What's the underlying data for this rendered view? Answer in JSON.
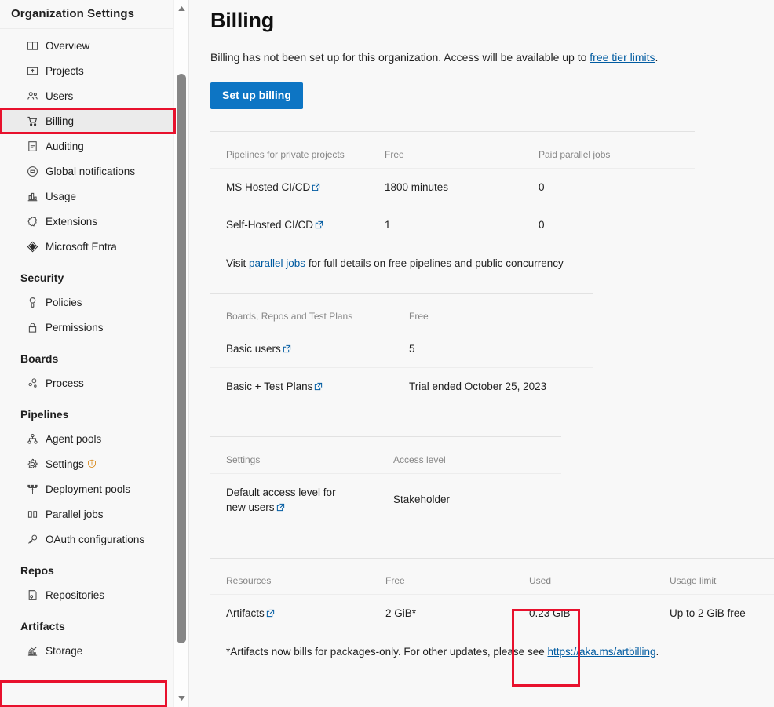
{
  "sidebar": {
    "title": "Organization Settings",
    "items": [
      {
        "label": "Overview",
        "icon": "overview-icon",
        "selected": false
      },
      {
        "label": "Projects",
        "icon": "projects-icon",
        "selected": false
      },
      {
        "label": "Users",
        "icon": "users-icon",
        "selected": false
      },
      {
        "label": "Billing",
        "icon": "billing-cart-icon",
        "selected": true
      },
      {
        "label": "Auditing",
        "icon": "auditing-icon",
        "selected": false
      },
      {
        "label": "Global notifications",
        "icon": "notifications-icon",
        "selected": false
      },
      {
        "label": "Usage",
        "icon": "usage-chart-icon",
        "selected": false
      },
      {
        "label": "Extensions",
        "icon": "extensions-icon",
        "selected": false
      },
      {
        "label": "Microsoft Entra",
        "icon": "entra-icon",
        "selected": false
      }
    ],
    "groups": [
      {
        "title": "Security",
        "items": [
          {
            "label": "Policies",
            "icon": "policies-shield-icon"
          },
          {
            "label": "Permissions",
            "icon": "permissions-lock-icon"
          }
        ]
      },
      {
        "title": "Boards",
        "items": [
          {
            "label": "Process",
            "icon": "process-icon"
          }
        ]
      },
      {
        "title": "Pipelines",
        "items": [
          {
            "label": "Agent pools",
            "icon": "agent-pools-icon"
          },
          {
            "label": "Settings",
            "icon": "settings-gear-icon",
            "warning": true
          },
          {
            "label": "Deployment pools",
            "icon": "deployment-pools-icon"
          },
          {
            "label": "Parallel jobs",
            "icon": "parallel-jobs-icon"
          },
          {
            "label": "OAuth configurations",
            "icon": "oauth-key-icon"
          }
        ]
      },
      {
        "title": "Repos",
        "items": [
          {
            "label": "Repositories",
            "icon": "repositories-icon"
          }
        ]
      },
      {
        "title": "Artifacts",
        "items": [
          {
            "label": "Storage",
            "icon": "storage-chart-icon",
            "highlighted": true
          }
        ]
      }
    ]
  },
  "main": {
    "title": "Billing",
    "intro_before": "Billing has not been set up for this organization. Access will be available up to ",
    "intro_link": "free tier limits",
    "intro_after": ".",
    "setup_button": "Set up billing",
    "pipelines_table": {
      "headers": [
        "Pipelines for private projects",
        "Free",
        "Paid parallel jobs"
      ],
      "rows": [
        {
          "name": "MS Hosted CI/CD",
          "external": true,
          "free": "1800 minutes",
          "paid": "0"
        },
        {
          "name": "Self-Hosted CI/CD",
          "external": true,
          "free": "1",
          "paid": "0"
        }
      ],
      "note_before": "Visit ",
      "note_link": "parallel jobs",
      "note_after": " for full details on free pipelines and public concurrency"
    },
    "boards_table": {
      "headers": [
        "Boards, Repos and Test Plans",
        "Free"
      ],
      "rows": [
        {
          "name": "Basic users",
          "external": true,
          "free": "5"
        },
        {
          "name": "Basic + Test Plans",
          "external": true,
          "free": "Trial ended October 25, 2023"
        }
      ]
    },
    "settings_table": {
      "headers": [
        "Settings",
        "Access level"
      ],
      "rows": [
        {
          "name": "Default access level for new users",
          "external": true,
          "value": "Stakeholder"
        }
      ]
    },
    "resources_table": {
      "headers": [
        "Resources",
        "Free",
        "Used",
        "Usage limit"
      ],
      "rows": [
        {
          "name": "Artifacts",
          "external": true,
          "free": "2 GiB*",
          "used": "0.23 GiB",
          "limit": "Up to 2 GiB free"
        }
      ],
      "note_before": "*Artifacts now bills for packages-only. For other updates, please see ",
      "note_link": "https://aka.ms/artbilling",
      "note_after": "."
    }
  },
  "colors": {
    "accent": "#0d75c4",
    "link": "#005ba1",
    "highlight_box": "#e8112d",
    "selected_row": "#ebebeb",
    "warning": "#d98b1e"
  }
}
